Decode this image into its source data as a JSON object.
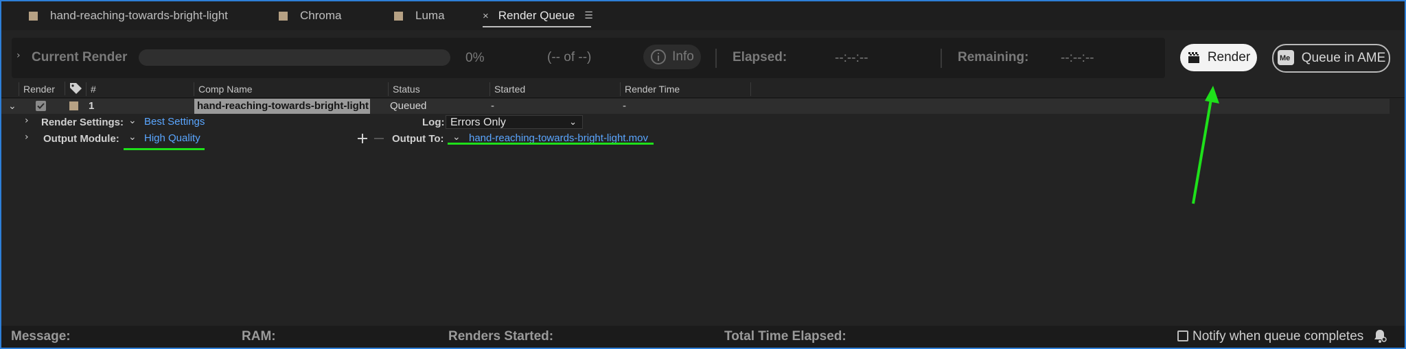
{
  "tabs": [
    {
      "label": "hand-reaching-towards-bright-light"
    },
    {
      "label": "Chroma"
    },
    {
      "label": "Luma"
    },
    {
      "label": "Render Queue",
      "close": "×",
      "menu": "☰"
    }
  ],
  "current_render": {
    "title": "Current Render",
    "progress_percent": "0%",
    "progress_value": 0,
    "of_text": "(-- of --)",
    "info_label": "Info",
    "elapsed_label": "Elapsed:",
    "elapsed_value": "--:--:--",
    "remaining_label": "Remaining:",
    "remaining_value": "--:--:--"
  },
  "buttons": {
    "render": "Render",
    "queue_ame": "Queue in AME"
  },
  "columns": {
    "render": "Render",
    "num": "#",
    "comp_name": "Comp Name",
    "status": "Status",
    "started": "Started",
    "render_time": "Render Time"
  },
  "item": {
    "number": "1",
    "comp_name": "hand-reaching-towards-bright-light",
    "status": "Queued",
    "started": "-",
    "render_time": "-"
  },
  "settings": {
    "render_settings_label": "Render Settings:",
    "render_settings_value": "Best Settings",
    "log_label": "Log:",
    "log_value": "Errors Only",
    "output_module_label": "Output Module:",
    "output_module_value": "High Quality",
    "output_to_label": "Output To:",
    "output_to_value": "hand-reaching-towards-bright-light.mov"
  },
  "footer": {
    "message": "Message:",
    "ram": "RAM:",
    "renders_started": "Renders Started:",
    "total_time": "Total Time Elapsed:",
    "notify": "Notify when queue completes"
  },
  "colors": {
    "accent_link": "#5aa6ff",
    "annotation_green": "#1ee01a",
    "swatch": "#b6a184"
  }
}
